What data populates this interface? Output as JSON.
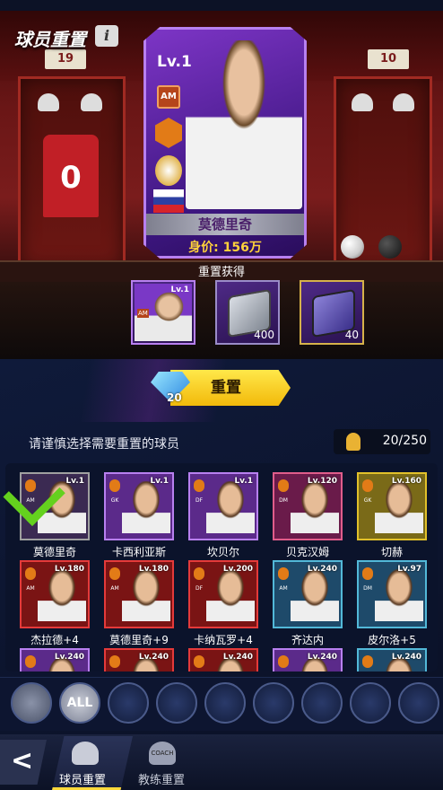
{
  "header": {
    "title": "球员重置",
    "info_icon": "i"
  },
  "scene": {
    "left_locker_number": "19",
    "right_locker_number": "10",
    "jersey_number": "0"
  },
  "featured_card": {
    "level": "Lv.1",
    "position": "AM",
    "name": "莫德里奇",
    "price": "身价: 156万"
  },
  "rewards": {
    "label": "重置获得",
    "items": [
      {
        "type": "player-card",
        "level": "Lv.1",
        "position": "AM"
      },
      {
        "type": "silver-book",
        "count": "400"
      },
      {
        "type": "purple-book",
        "count": "40"
      }
    ]
  },
  "reset_button": {
    "label": "重置",
    "cost": "20"
  },
  "selection": {
    "warning": "请谨慎选择需要重置的球员",
    "count": "20/250"
  },
  "players": [
    {
      "name": "莫德里奇",
      "level": "Lv.1",
      "position": "AM",
      "selected": true
    },
    {
      "name": "卡西利亚斯",
      "level": "Lv.1",
      "position": "GK"
    },
    {
      "name": "坎贝尔",
      "level": "Lv.1",
      "position": "DF"
    },
    {
      "name": "贝克汉姆",
      "level": "Lv.120",
      "position": "DM"
    },
    {
      "name": "切赫",
      "level": "Lv.160",
      "position": "GK"
    },
    {
      "name": "杰拉德+4",
      "level": "Lv.180",
      "position": "AM"
    },
    {
      "name": "莫德里奇+9",
      "level": "Lv.180",
      "position": "AM"
    },
    {
      "name": "卡纳瓦罗+4",
      "level": "Lv.200",
      "position": "DF"
    },
    {
      "name": "齐达内",
      "level": "Lv.240",
      "position": "AM"
    },
    {
      "name": "皮尔洛+5",
      "level": "Lv.97",
      "position": "DM"
    },
    {
      "name": "",
      "level": "Lv.240",
      "position": ""
    },
    {
      "name": "",
      "level": "Lv.240",
      "position": ""
    },
    {
      "name": "",
      "level": "Lv.240",
      "position": ""
    },
    {
      "name": "",
      "level": "Lv.240",
      "position": "F"
    },
    {
      "name": "",
      "level": "Lv.240",
      "position": ""
    }
  ],
  "filters": [
    {
      "label": "",
      "icon": "chevron-up-icon"
    },
    {
      "label": "ALL",
      "icon": "all-filter"
    },
    {
      "label": "",
      "icon": "premier-league-icon"
    },
    {
      "label": "",
      "icon": "laliga-icon"
    },
    {
      "label": "",
      "icon": "serie-a-icon"
    },
    {
      "label": "",
      "icon": "f-league-icon"
    },
    {
      "label": "",
      "icon": "p-league-icon"
    },
    {
      "label": "",
      "icon": "trophy-icon"
    },
    {
      "label": "",
      "icon": "ring-icon"
    }
  ],
  "nav": {
    "back": "<",
    "tab1": "球员重置",
    "tab2": "教练重置",
    "coach_label": "COACH"
  },
  "colors": {
    "accent": "#ffd93a",
    "purple": "#7d35c6",
    "green": "#64d11e"
  }
}
